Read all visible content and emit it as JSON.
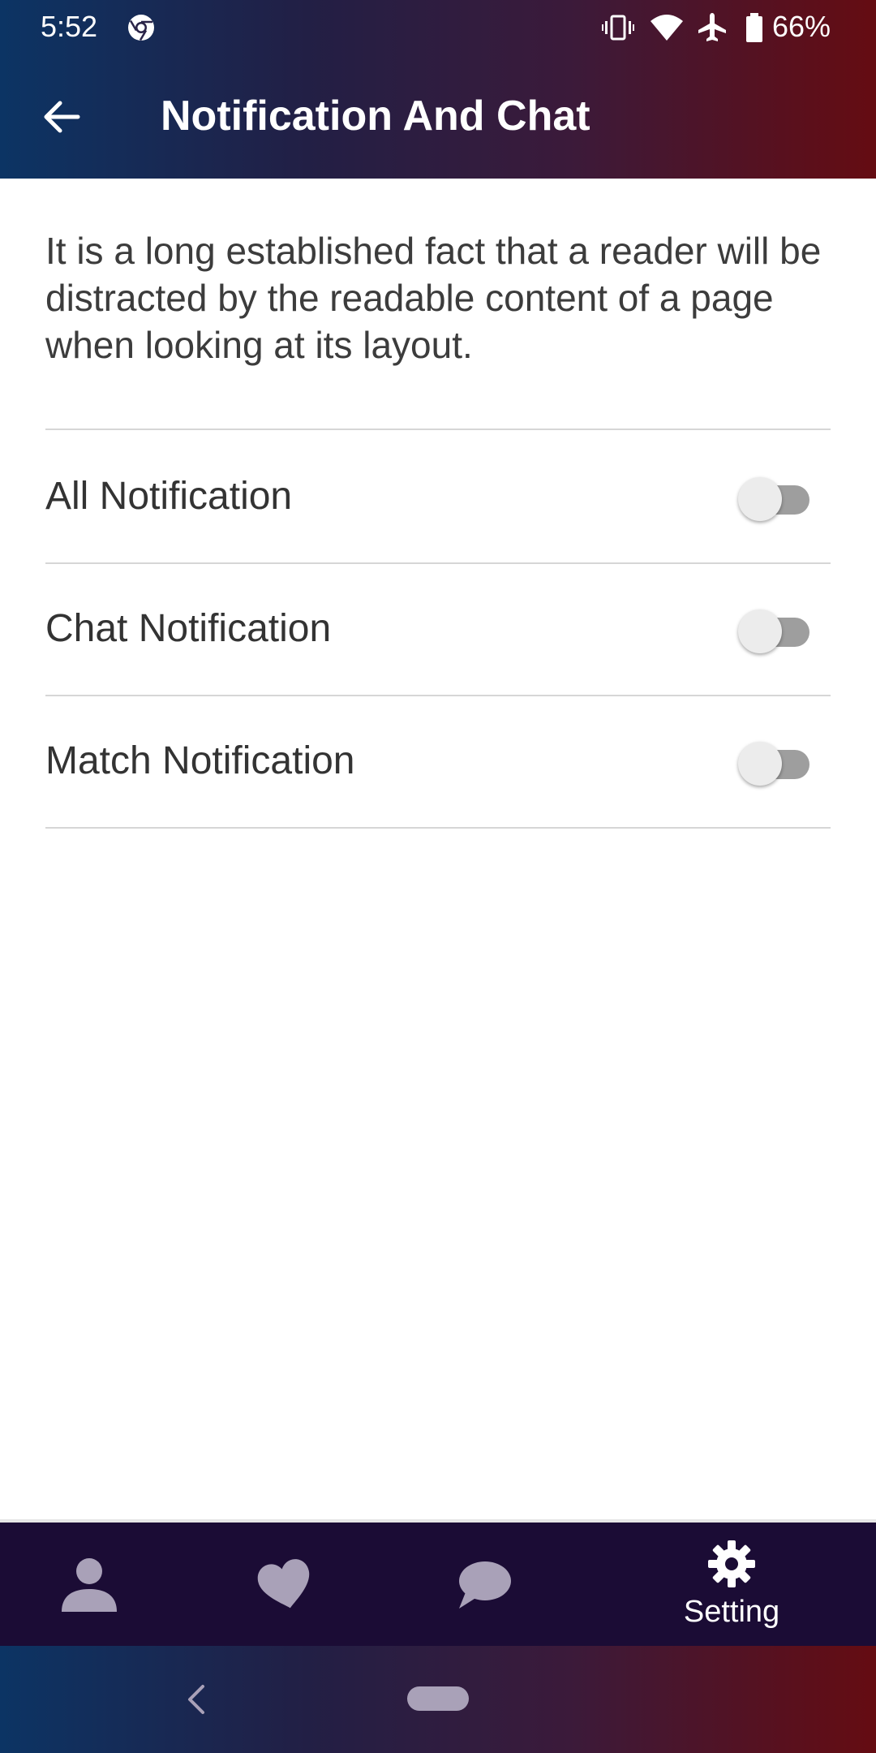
{
  "status_bar": {
    "time": "5:52",
    "battery": "66%",
    "icons": [
      "chrome-icon",
      "vibrate-icon",
      "wifi-icon",
      "airplane-icon",
      "battery-icon"
    ]
  },
  "app_bar": {
    "title": "Notification And Chat",
    "back_icon": "arrow-left-icon"
  },
  "intro": {
    "text": "It is a long established fact that a reader will be distracted by the readable content of a page when looking at its layout."
  },
  "settings": [
    {
      "label": "All Notification",
      "enabled": false
    },
    {
      "label": "Chat Notification",
      "enabled": false
    },
    {
      "label": "Match Notification",
      "enabled": false
    }
  ],
  "bottom_nav": {
    "items": [
      {
        "icon": "person-icon",
        "label": "",
        "active": false
      },
      {
        "icon": "heart-icon",
        "label": "",
        "active": false
      },
      {
        "icon": "chat-bubble-icon",
        "label": "",
        "active": false
      },
      {
        "icon": "gear-icon",
        "label": "Setting",
        "active": true
      }
    ]
  },
  "colors": {
    "header_gradient_start": "#0c3464",
    "header_gradient_end": "#650c12",
    "bottom_nav_bg": "#1b0c35",
    "inactive_icon": "#a9a1b8",
    "active_icon": "#ffffff",
    "toggle_off_track": "#9e9e9e",
    "toggle_off_thumb": "#ececec"
  }
}
